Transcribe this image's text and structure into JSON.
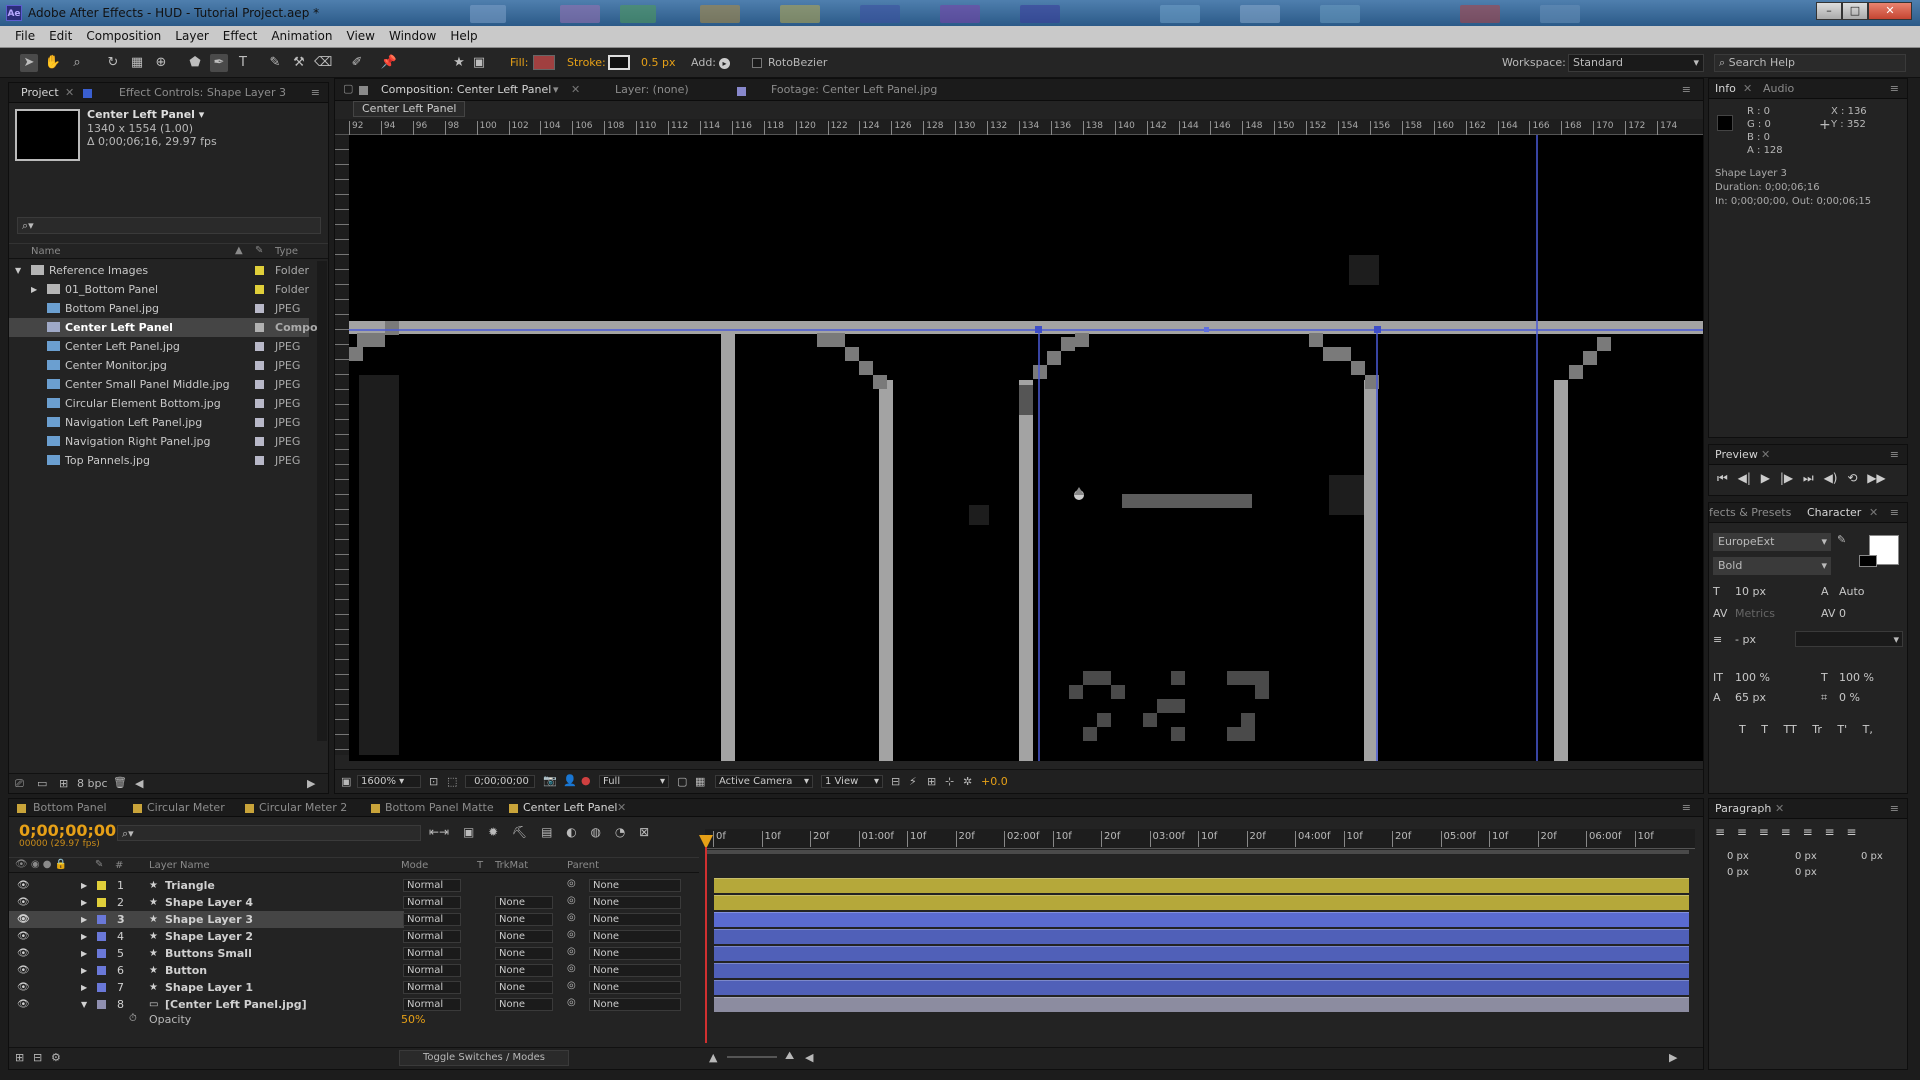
{
  "window": {
    "title": "Adobe After Effects - HUD - Tutorial Project.aep *",
    "app_badge": "Ae",
    "minimize": "–",
    "maximize": "□",
    "close": "✕"
  },
  "menu": [
    "File",
    "Edit",
    "Composition",
    "Layer",
    "Effect",
    "Animation",
    "View",
    "Window",
    "Help"
  ],
  "toolbar": {
    "fill_label": "Fill:",
    "stroke_label": "Stroke:",
    "stroke_width": "0.5 px",
    "add_label": "Add:",
    "rotobezier": "RotoBezier",
    "workspace_label": "Workspace:",
    "workspace_value": "Standard",
    "search_placeholder": "Search Help"
  },
  "project": {
    "tabs": [
      "Project",
      "Effect Controls: Shape Layer 3"
    ],
    "comp_name": "Center Left Panel ▾",
    "comp_info_1": "1340 x 1554 (1.00)",
    "comp_info_2": "Δ 0;00;06;16, 29.97 fps",
    "col_name": "Name",
    "col_type": "Type",
    "items": [
      {
        "name": "Reference Images",
        "type": "Folder",
        "indent": 0,
        "kind": "folder",
        "open": true
      },
      {
        "name": "01_Bottom Panel",
        "type": "Folder",
        "indent": 1,
        "kind": "folder",
        "open": false
      },
      {
        "name": "Bottom Panel.jpg",
        "type": "JPEG",
        "indent": 1,
        "kind": "image"
      },
      {
        "name": "Center Left Panel",
        "type": "Compo",
        "indent": 1,
        "kind": "comp",
        "selected": true
      },
      {
        "name": "Center Left Panel.jpg",
        "type": "JPEG",
        "indent": 1,
        "kind": "image"
      },
      {
        "name": "Center Monitor.jpg",
        "type": "JPEG",
        "indent": 1,
        "kind": "image"
      },
      {
        "name": "Center Small Panel Middle.jpg",
        "type": "JPEG",
        "indent": 1,
        "kind": "image"
      },
      {
        "name": "Circular Element Bottom.jpg",
        "type": "JPEG",
        "indent": 1,
        "kind": "image"
      },
      {
        "name": "Navigation Left Panel.jpg",
        "type": "JPEG",
        "indent": 1,
        "kind": "image"
      },
      {
        "name": "Navigation Right Panel.jpg",
        "type": "JPEG",
        "indent": 1,
        "kind": "image"
      },
      {
        "name": "Top Pannels.jpg",
        "type": "JPEG",
        "indent": 1,
        "kind": "image"
      }
    ],
    "bpc": "8 bpc"
  },
  "comp": {
    "tabs": [
      "Composition: Center Left Panel",
      "Layer: (none)",
      "Footage: Center Left Panel.jpg"
    ],
    "breadcrumb": "Center Left Panel",
    "ruler": [
      "92",
      "94",
      "96",
      "98",
      "100",
      "102",
      "104",
      "106",
      "108",
      "110",
      "112",
      "114",
      "116",
      "118",
      "120",
      "122",
      "124",
      "126",
      "128",
      "130",
      "132",
      "134",
      "136",
      "138",
      "140",
      "142",
      "144",
      "146",
      "148",
      "150",
      "152",
      "154",
      "156",
      "158",
      "160",
      "162",
      "164",
      "166",
      "168",
      "170",
      "172",
      "174"
    ],
    "zoom": "1600%",
    "timecode": "0;00;00;00",
    "resolution": "Full",
    "camera": "Active Camera",
    "views": "1 View",
    "exposure": "+0.0"
  },
  "info": {
    "tabs": [
      "Info",
      "Audio"
    ],
    "r": "R : 0",
    "g": "G : 0",
    "b": "B : 0",
    "a": "A : 128",
    "x": "X : 136",
    "y": "Y : 352",
    "layer_name": "Shape Layer 3",
    "duration": "Duration: 0;00;06;16",
    "inout": "In: 0;00;00;00, Out: 0;00;06;15"
  },
  "preview": {
    "tab": "Preview"
  },
  "character": {
    "tabs": [
      "fects & Presets",
      "Character"
    ],
    "font": "EuropeExt",
    "style": "Bold",
    "size": "10 px",
    "leading": "Auto",
    "kerning": "Metrics",
    "tracking": "0",
    "stroke": "- px",
    "vscale": "100 %",
    "hscale": "100 %",
    "baseline": "65 px",
    "tsume": "0 %",
    "styles": [
      "T",
      "T",
      "TT",
      "Tr",
      "T'",
      "T,"
    ]
  },
  "paragraph": {
    "tab": "Paragraph",
    "v1": "0 px",
    "v2": "0 px",
    "v3": "0 px",
    "v4": "0 px",
    "v5": "0 px"
  },
  "timeline": {
    "tabs": [
      "Bottom Panel",
      "Circular Meter",
      "Circular Meter 2",
      "Bottom Panel Matte",
      "Center Left Panel"
    ],
    "tab_colors": [
      "#c9a43a",
      "#c9a43a",
      "#c9a43a",
      "#c9a43a",
      "#c9a43a"
    ],
    "timecode": "0;00;00;00",
    "fps": "00000 (29.97 fps)",
    "headers": {
      "num": "#",
      "name": "Layer Name",
      "mode": "Mode",
      "t": "T",
      "trkmat": "TrkMat",
      "parent": "Parent"
    },
    "ruler": [
      "0f",
      "10f",
      "20f",
      "01:00f",
      "10f",
      "20f",
      "02:00f",
      "10f",
      "20f",
      "03:00f",
      "10f",
      "20f",
      "04:00f",
      "10f",
      "20f",
      "05:00f",
      "10f",
      "20f",
      "06:00f",
      "10f"
    ],
    "layers": [
      {
        "num": "1",
        "name": "Triangle",
        "mode": "Normal",
        "trkmat": "",
        "parent": "None",
        "color": "#e0cf3a",
        "bar": "#b5a83a",
        "selected": false
      },
      {
        "num": "2",
        "name": "Shape Layer 4",
        "mode": "Normal",
        "trkmat": "None",
        "parent": "None",
        "color": "#e0cf3a",
        "bar": "#b5a83a",
        "selected": false
      },
      {
        "num": "3",
        "name": "Shape Layer 3",
        "mode": "Normal",
        "trkmat": "None",
        "parent": "None",
        "color": "#6a78d8",
        "bar": "#5a6bd0",
        "selected": true
      },
      {
        "num": "4",
        "name": "Shape Layer 2",
        "mode": "Normal",
        "trkmat": "None",
        "parent": "None",
        "color": "#6a78d8",
        "bar": "#5060b8",
        "selected": false
      },
      {
        "num": "5",
        "name": "Buttons Small",
        "mode": "Normal",
        "trkmat": "None",
        "parent": "None",
        "color": "#6a78d8",
        "bar": "#5060b8",
        "selected": false
      },
      {
        "num": "6",
        "name": "Button",
        "mode": "Normal",
        "trkmat": "None",
        "parent": "None",
        "color": "#6a78d8",
        "bar": "#5060b8",
        "selected": false
      },
      {
        "num": "7",
        "name": "Shape Layer 1",
        "mode": "Normal",
        "trkmat": "None",
        "parent": "None",
        "color": "#6a78d8",
        "bar": "#5060b8",
        "selected": false
      },
      {
        "num": "8",
        "name": "[Center Left Panel.jpg]",
        "mode": "Normal",
        "trkmat": "None",
        "parent": "None",
        "color": "#8f8fb0",
        "bar": "#8c8ca0",
        "selected": false
      }
    ],
    "opacity_label": "Opacity",
    "opacity_value": "50%",
    "toggle": "Toggle Switches / Modes"
  }
}
